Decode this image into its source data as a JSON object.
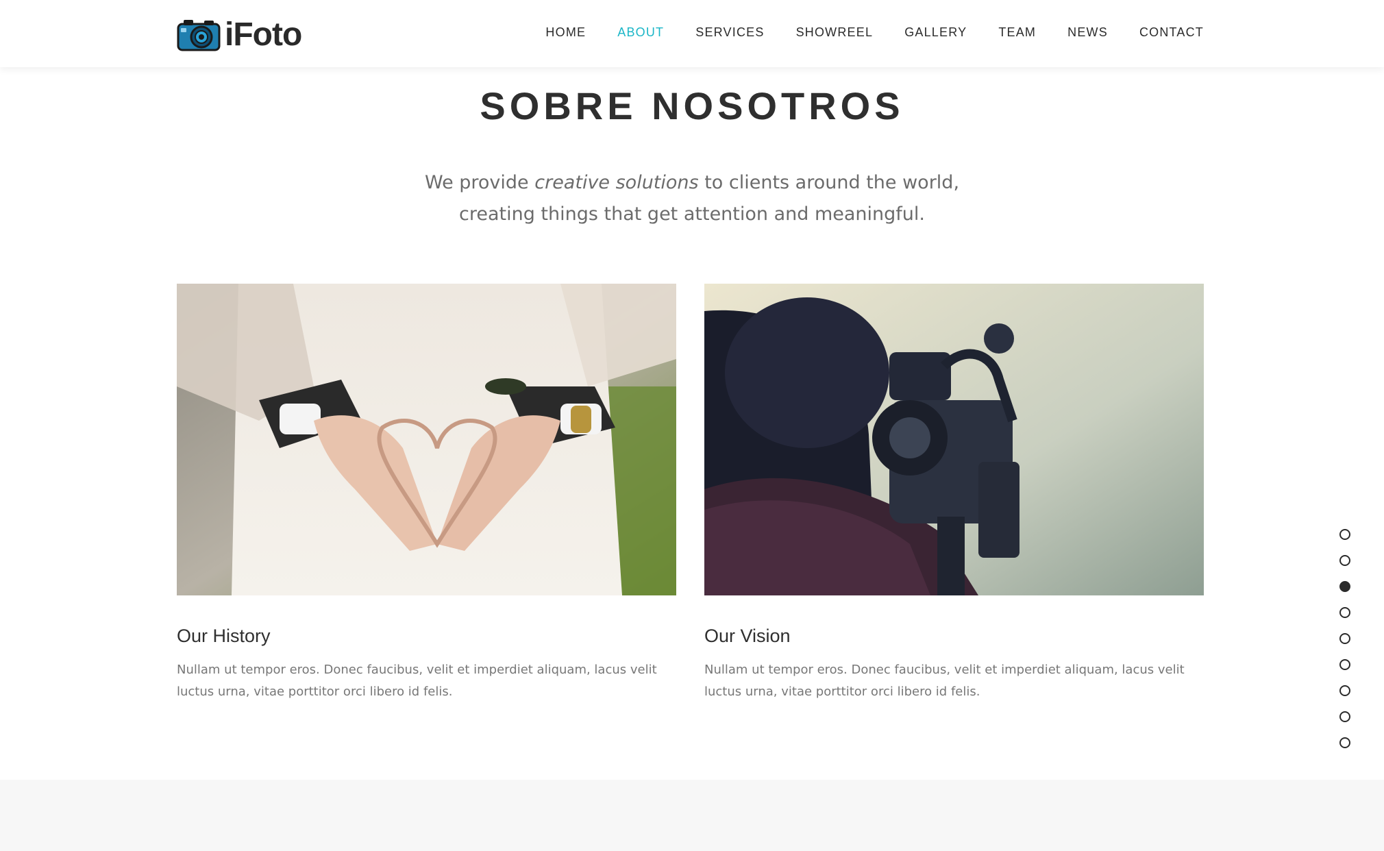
{
  "brand": {
    "name": "iFoto",
    "icon": "camera-icon",
    "accent": "#1bb6c7"
  },
  "nav": {
    "items": [
      {
        "label": "HOME"
      },
      {
        "label": "ABOUT",
        "active": true
      },
      {
        "label": "SERVICES"
      },
      {
        "label": "SHOWREEL"
      },
      {
        "label": "GALLERY"
      },
      {
        "label": "TEAM"
      },
      {
        "label": "NEWS"
      },
      {
        "label": "CONTACT"
      }
    ]
  },
  "about": {
    "title": "SOBRE NOSOTROS",
    "lead": {
      "before": "We provide ",
      "emphasis": "creative solutions",
      "after": " to clients around the world,",
      "line2": "creating things that get attention and meaningful."
    },
    "cards": [
      {
        "title": "Our History",
        "text": "Nullam ut tempor eros. Donec faucibus, velit et imperdiet aliquam, lacus velit luctus urna, vitae porttitor orci libero id felis."
      },
      {
        "title": "Our Vision",
        "text": "Nullam ut tempor eros. Donec faucibus, velit et imperdiet aliquam, lacus velit luctus urna, vitae porttitor orci libero id felis."
      }
    ]
  },
  "dotnav": {
    "count": 9,
    "active_index": 2
  }
}
